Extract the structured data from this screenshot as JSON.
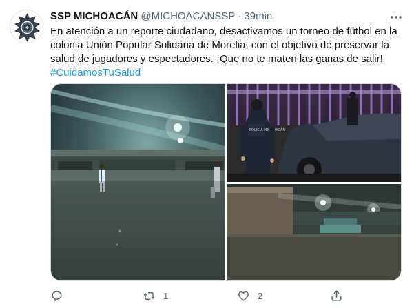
{
  "tweet": {
    "author_name": "SSP MICHOACÁN",
    "handle": "@MICHOACANSSP",
    "separator": "·",
    "time": "39min",
    "text": "En atención a un reporte ciudadano, desactivamos un torneo de fútbol en la colonia Unión Popular Solidaria de Morelia, con el objetivo de preservar la salud de jugadores y espectadores. ¡Que no te maten las ganas de salir!",
    "hashtag": "#CuidamosTuSalud",
    "patch_text": "POLICÍA MICHOACÁN"
  },
  "media": {
    "photos": [
      {
        "name": "photo-soccer-field-night"
      },
      {
        "name": "photo-police-officer-car"
      },
      {
        "name": "photo-empty-field-night"
      }
    ]
  },
  "actions": {
    "reply_count": "",
    "retweet_count": "1",
    "like_count": "2",
    "share_count": ""
  },
  "colors": {
    "text_primary": "#0f1419",
    "text_secondary": "#536471",
    "link": "#1d9bf0",
    "border": "#cfd9de"
  },
  "icons": [
    "more-icon",
    "reply-icon",
    "retweet-icon",
    "like-icon",
    "share-icon"
  ]
}
